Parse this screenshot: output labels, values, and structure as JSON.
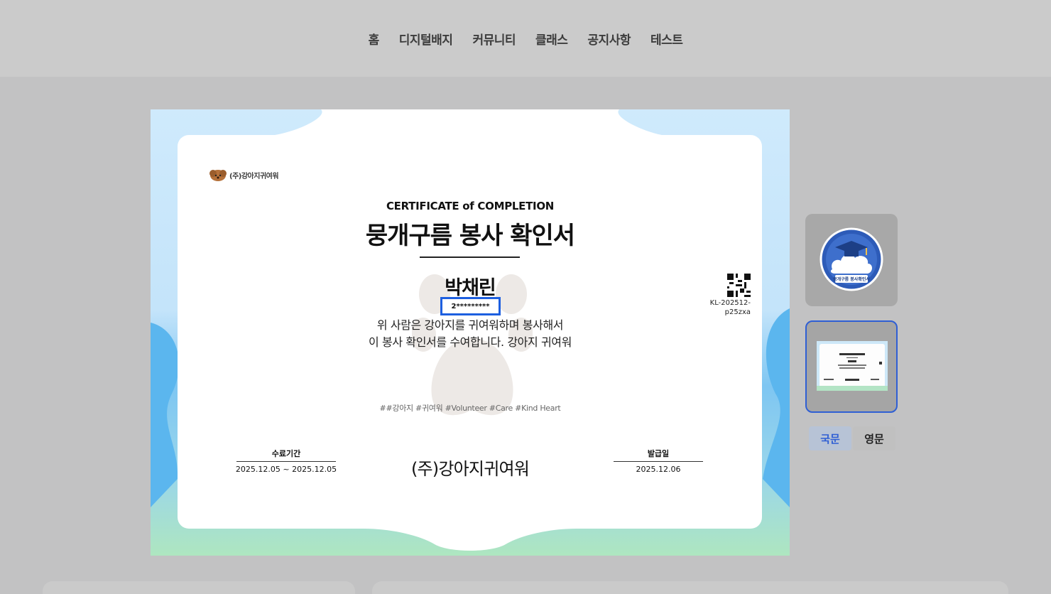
{
  "nav": {
    "items": [
      {
        "label": "홈"
      },
      {
        "label": "디지털배지"
      },
      {
        "label": "커뮤니티"
      },
      {
        "label": "클래스"
      },
      {
        "label": "공지사항"
      },
      {
        "label": "테스트"
      }
    ]
  },
  "certificate": {
    "brand": "(주)강아지귀여워",
    "heading_en": "CERTIFICATE of COMPLETION",
    "title": "뭉개구름 봉사 확인서",
    "recipient": "박채린",
    "masked_id": "2*********",
    "description_line1": "위 사람은 강아지를 귀여워하며 봉사해서",
    "description_line2": "이 봉사 확인서를 수여합니다. 강아지 귀여워",
    "cert_code_line1": "KL-202512-",
    "cert_code_line2": "p25zxa",
    "hashtags": "##강아지 #귀여워 #Volunteer #Care #Kind Heart",
    "period_label": "수료기간",
    "period_value": "2025.12.05 ~ 2025.12.05",
    "organization": "(주)강아지귀여워",
    "issue_label": "발급일",
    "issue_value": "2025.12.06"
  },
  "thumbnails": {
    "badge_text": "뭉개구름 봉사확인서"
  },
  "language_tabs": {
    "korean": "국문",
    "english": "영문",
    "active": "korean"
  },
  "colors": {
    "accent": "#2f5fd4",
    "id_highlight": "#1d5fe0",
    "cert_sky": "#cbe8fb",
    "cert_blue": "#63b9ef",
    "cert_green": "#a6e2be"
  }
}
